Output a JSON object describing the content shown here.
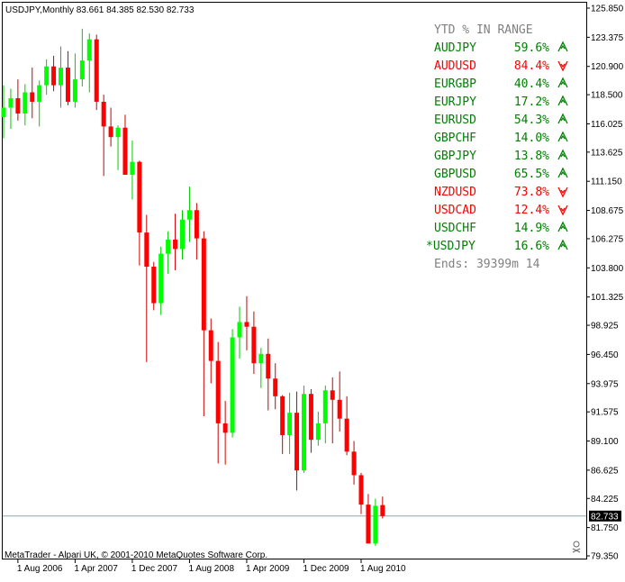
{
  "header": {
    "symbol_line": "USDJPY,Monthly  83.661 84.385 82.530 82.733"
  },
  "footer": {
    "copyright": "MetaTrader - Alpari UK, © 2001-2010 MetaQuotes Software Corp."
  },
  "colors": {
    "background": "#ffffff",
    "bull": "#00ff00",
    "bear": "#ff0000",
    "wick_bull": "#00cc00",
    "wick_bear": "#cc0000",
    "axis": "#000000",
    "price_line": "#8fa8a8",
    "panel_green": "#008000",
    "panel_red": "#ff0000",
    "panel_gray": "#808080"
  },
  "panel": {
    "title": "YTD % IN RANGE",
    "rows": [
      {
        "symbol": "AUDJPY",
        "value": "59.6%",
        "arrow": "up",
        "color": "green"
      },
      {
        "symbol": "AUDUSD",
        "value": "84.4%",
        "arrow": "down",
        "color": "red"
      },
      {
        "symbol": "EURGBP",
        "value": "40.4%",
        "arrow": "up",
        "color": "green"
      },
      {
        "symbol": "EURJPY",
        "value": "17.2%",
        "arrow": "up",
        "color": "green"
      },
      {
        "symbol": "EURUSD",
        "value": "54.3%",
        "arrow": "up",
        "color": "green"
      },
      {
        "symbol": "GBPCHF",
        "value": "14.0%",
        "arrow": "up",
        "color": "green"
      },
      {
        "symbol": "GBPJPY",
        "value": "13.8%",
        "arrow": "up",
        "color": "green"
      },
      {
        "symbol": "GBPUSD",
        "value": "65.5%",
        "arrow": "up",
        "color": "green"
      },
      {
        "symbol": "NZDUSD",
        "value": "73.8%",
        "arrow": "down",
        "color": "red"
      },
      {
        "symbol": "USDCAD",
        "value": "12.4%",
        "arrow": "down",
        "color": "red"
      },
      {
        "symbol": "USDCHF",
        "value": "14.9%",
        "arrow": "up",
        "color": "green"
      },
      {
        "symbol": "*USDJPY",
        "value": "16.6%",
        "arrow": "up",
        "color": "green"
      }
    ],
    "ends": "Ends: 39399m 14"
  },
  "chart_data": {
    "type": "candlestick",
    "symbol": "USDJPY",
    "timeframe": "Monthly",
    "ylim": [
      79.35,
      125.85
    ],
    "current_price": 82.733,
    "current_price_label": "82.733",
    "y_ticks": [
      "125.850",
      "123.375",
      "120.900",
      "118.500",
      "116.025",
      "113.625",
      "111.150",
      "108.675",
      "106.275",
      "103.800",
      "101.325",
      "98.925",
      "96.450",
      "93.975",
      "91.575",
      "89.100",
      "86.625",
      "84.225",
      "81.750",
      "79.350"
    ],
    "x_ticks": [
      {
        "label": "1 Aug 2006",
        "index": 2
      },
      {
        "label": "1 Apr 2007",
        "index": 10
      },
      {
        "label": "1 Dec 2007",
        "index": 18
      },
      {
        "label": "1 Aug 2008",
        "index": 26
      },
      {
        "label": "1 Apr 2009",
        "index": 34
      },
      {
        "label": "1 Dec 2009",
        "index": 42
      },
      {
        "label": "1 Aug 2010",
        "index": 50
      }
    ],
    "candles": [
      {
        "o": 116.6,
        "h": 119.3,
        "l": 114.8,
        "c": 117.4
      },
      {
        "o": 117.4,
        "h": 119.0,
        "l": 115.6,
        "c": 118.2
      },
      {
        "o": 118.2,
        "h": 119.8,
        "l": 116.3,
        "c": 116.9
      },
      {
        "o": 116.9,
        "h": 119.4,
        "l": 115.9,
        "c": 118.7
      },
      {
        "o": 118.7,
        "h": 120.8,
        "l": 116.5,
        "c": 117.9
      },
      {
        "o": 117.9,
        "h": 119.7,
        "l": 115.8,
        "c": 119.3
      },
      {
        "o": 119.3,
        "h": 121.5,
        "l": 118.5,
        "c": 120.9
      },
      {
        "o": 120.9,
        "h": 121.8,
        "l": 118.8,
        "c": 119.3
      },
      {
        "o": 119.3,
        "h": 122.6,
        "l": 117.4,
        "c": 120.8
      },
      {
        "o": 120.8,
        "h": 122.2,
        "l": 117.6,
        "c": 117.9
      },
      {
        "o": 117.9,
        "h": 122.0,
        "l": 117.4,
        "c": 119.8
      },
      {
        "o": 119.8,
        "h": 124.1,
        "l": 119.2,
        "c": 121.4
      },
      {
        "o": 121.4,
        "h": 123.7,
        "l": 118.7,
        "c": 123.2
      },
      {
        "o": 123.2,
        "h": 123.6,
        "l": 117.2,
        "c": 117.9
      },
      {
        "o": 117.9,
        "h": 118.5,
        "l": 111.6,
        "c": 115.8
      },
      {
        "o": 115.8,
        "h": 117.4,
        "l": 114.1,
        "c": 114.9
      },
      {
        "o": 114.9,
        "h": 115.9,
        "l": 112.1,
        "c": 115.7
      },
      {
        "o": 115.7,
        "h": 116.8,
        "l": 111.8,
        "c": 111.7
      },
      {
        "o": 111.7,
        "h": 114.6,
        "l": 109.6,
        "c": 112.8
      },
      {
        "o": 112.8,
        "h": 112.9,
        "l": 104.0,
        "c": 106.8
      },
      {
        "o": 106.8,
        "h": 108.3,
        "l": 95.8,
        "c": 103.9
      },
      {
        "o": 103.9,
        "h": 104.3,
        "l": 100.2,
        "c": 100.8
      },
      {
        "o": 100.8,
        "h": 105.6,
        "l": 99.8,
        "c": 105.0
      },
      {
        "o": 105.0,
        "h": 106.9,
        "l": 103.3,
        "c": 106.2
      },
      {
        "o": 106.2,
        "h": 108.4,
        "l": 103.6,
        "c": 105.4
      },
      {
        "o": 105.4,
        "h": 108.7,
        "l": 104.5,
        "c": 107.9
      },
      {
        "o": 107.9,
        "h": 110.7,
        "l": 106.0,
        "c": 108.7
      },
      {
        "o": 108.7,
        "h": 109.3,
        "l": 104.5,
        "c": 106.3
      },
      {
        "o": 106.3,
        "h": 106.9,
        "l": 91.2,
        "c": 98.5
      },
      {
        "o": 98.5,
        "h": 99.5,
        "l": 94.0,
        "c": 95.9
      },
      {
        "o": 95.9,
        "h": 97.5,
        "l": 87.2,
        "c": 90.6
      },
      {
        "o": 90.6,
        "h": 92.5,
        "l": 87.1,
        "c": 89.8
      },
      {
        "o": 89.8,
        "h": 98.6,
        "l": 89.4,
        "c": 97.9
      },
      {
        "o": 97.9,
        "h": 100.5,
        "l": 96.1,
        "c": 99.2
      },
      {
        "o": 99.2,
        "h": 101.4,
        "l": 96.8,
        "c": 98.8
      },
      {
        "o": 98.8,
        "h": 100.1,
        "l": 94.8,
        "c": 95.7
      },
      {
        "o": 95.7,
        "h": 97.0,
        "l": 93.6,
        "c": 96.5
      },
      {
        "o": 96.5,
        "h": 97.8,
        "l": 91.7,
        "c": 94.4
      },
      {
        "o": 94.4,
        "h": 95.7,
        "l": 91.8,
        "c": 92.9
      },
      {
        "o": 92.9,
        "h": 93.0,
        "l": 88.0,
        "c": 89.6
      },
      {
        "o": 89.6,
        "h": 93.2,
        "l": 88.0,
        "c": 91.5
      },
      {
        "o": 91.5,
        "h": 93.3,
        "l": 84.9,
        "c": 86.6
      },
      {
        "o": 86.6,
        "h": 93.8,
        "l": 86.4,
        "c": 93.1
      },
      {
        "o": 93.1,
        "h": 93.5,
        "l": 88.1,
        "c": 89.2
      },
      {
        "o": 89.2,
        "h": 91.6,
        "l": 88.7,
        "c": 90.6
      },
      {
        "o": 90.6,
        "h": 93.8,
        "l": 88.9,
        "c": 93.4
      },
      {
        "o": 93.4,
        "h": 94.5,
        "l": 88.9,
        "c": 92.6
      },
      {
        "o": 92.6,
        "h": 95.0,
        "l": 89.9,
        "c": 91.0
      },
      {
        "o": 91.0,
        "h": 92.9,
        "l": 87.9,
        "c": 88.2
      },
      {
        "o": 88.2,
        "h": 89.1,
        "l": 85.4,
        "c": 86.2
      },
      {
        "o": 86.2,
        "h": 86.4,
        "l": 82.9,
        "c": 83.7
      },
      {
        "o": 83.7,
        "h": 84.6,
        "l": 80.5,
        "c": 80.4
      },
      {
        "o": 80.4,
        "h": 84.2,
        "l": 80.2,
        "c": 83.6
      },
      {
        "o": 83.661,
        "h": 84.385,
        "l": 82.53,
        "c": 82.733
      }
    ]
  }
}
